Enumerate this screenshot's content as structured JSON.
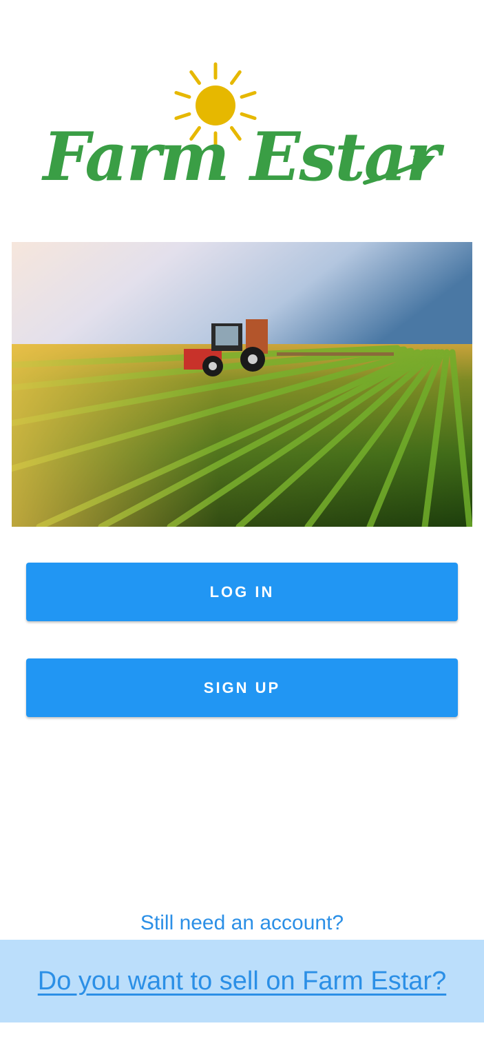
{
  "colors": {
    "brand_green": "#3a9e45",
    "sun_yellow": "#e6b800",
    "button_blue": "#2196f3",
    "link_blue": "#2b8fe6",
    "banner_bg": "#bbdefb"
  },
  "logo": {
    "text": "Farm Estar",
    "icons": [
      "sun-icon",
      "arrow-icon"
    ]
  },
  "hero": {
    "icon": "tractor-field-image"
  },
  "actions": {
    "login_label": "LOG IN",
    "signup_label": "SIGN UP"
  },
  "footer": {
    "account_link": "Still need an account?",
    "sell_link": "Do you want to sell on Farm Estar?"
  }
}
